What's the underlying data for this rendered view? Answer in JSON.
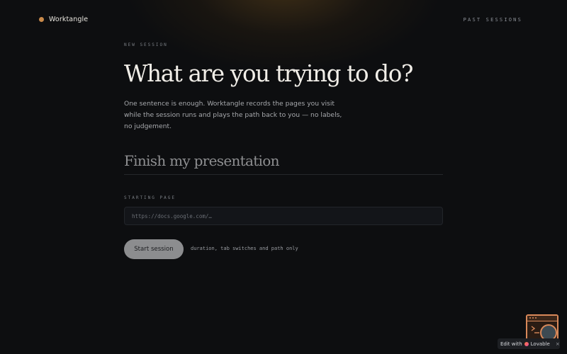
{
  "app": {
    "brand_name": "Worktangle",
    "brand_dot_color": "#c98a4a",
    "nav_past_sessions": "PAST SESSIONS"
  },
  "session": {
    "eyebrow": "NEW SESSION",
    "headline": "What are you trying to do?",
    "intro": "One sentence is enough. Worktangle records the pages you visit while the session runs and plays the path back to you — no labels, no judgement.",
    "goal_value": "Finish my presentation",
    "starting_page_label": "STARTING PAGE",
    "starting_page_placeholder": "https://docs.google.com/…",
    "starting_page_value": "",
    "start_button_label": "Start session",
    "hint": "duration, tab switches and path only"
  },
  "badge": {
    "edit_with": "Edit with",
    "lovable": "Lovable",
    "close_icon": "close-icon"
  },
  "colors": {
    "background": "#0d0e10",
    "accent": "#c98a4a",
    "button_bg": "#8c8d8f"
  }
}
